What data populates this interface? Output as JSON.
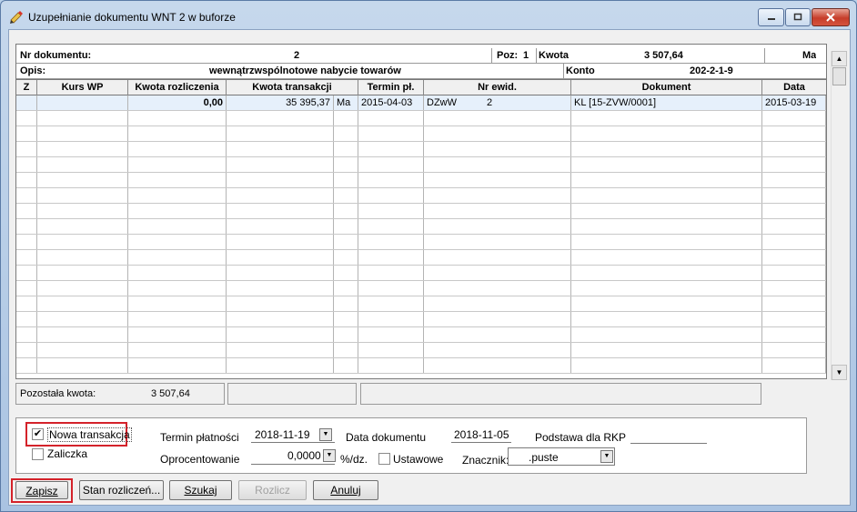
{
  "window": {
    "title": "Uzupełnianie dokumentu WNT 2 w buforze"
  },
  "header": {
    "nr_label": "Nr dokumentu:",
    "nr_value": "2",
    "poz_label": "Poz:",
    "poz_value": "1",
    "kwota_label": "Kwota",
    "kwota_value": "3 507,64",
    "side": "Ma",
    "opis_label": "Opis:",
    "opis_value": "wewnątrzwspólnotowe nabycie towarów",
    "konto_label": "Konto",
    "konto_value": "202-2-1-9"
  },
  "columns": [
    "Z",
    "Kurs WP",
    "Kwota rozliczenia",
    "Kwota transakcji",
    "Termin pł.",
    "Nr ewid.",
    "Dokument",
    "Data"
  ],
  "rows": [
    {
      "z": "",
      "kurs": "",
      "kwota_rozl": "0,00",
      "kwota_trans": "35 395,37",
      "strona": "Ma",
      "termin": "2015-04-03",
      "nr_ewid_typ": "DZwW",
      "nr_ewid_nr": "2",
      "dokument": "KL [15-ZVW/0001]",
      "data": "2015-03-19"
    }
  ],
  "remaining": {
    "label": "Pozostała kwota:",
    "value": "3 507,64"
  },
  "options": {
    "nowa_transakcja": {
      "label": "Nowa transakcja",
      "checked": true
    },
    "zaliczka": {
      "label": "Zaliczka",
      "checked": false
    },
    "termin_platnosci": {
      "label": "Termin płatności",
      "value": "2018-11-19"
    },
    "data_dokumentu": {
      "label": "Data dokumentu",
      "value": "2018-11-05"
    },
    "podstawa_rkp": {
      "label": "Podstawa dla RKP",
      "value": ""
    },
    "oprocentowanie": {
      "label": "Oprocentowanie",
      "value": "0,0000",
      "unit": "%/dz."
    },
    "ustawowe": {
      "label": "Ustawowe",
      "checked": false
    },
    "znacznik": {
      "label": "Znacznik:",
      "value": ".puste"
    }
  },
  "buttons": {
    "zapisz": "Zapisz",
    "stan": "Stan rozliczeń...",
    "szukaj": "Szukaj",
    "rozlicz": "Rozlicz",
    "anuluj": "Anuluj"
  }
}
